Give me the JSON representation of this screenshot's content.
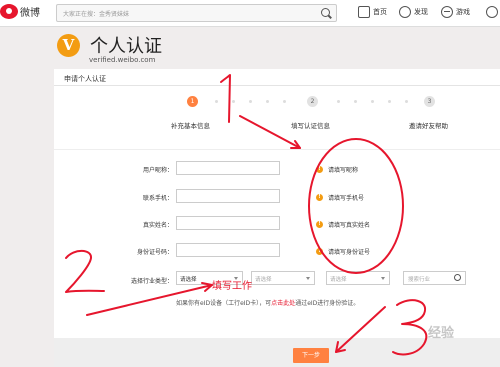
{
  "topbar": {
    "logo_text": "微博",
    "search_placeholder": "大家正在搜：金秀贤妹妹",
    "nav": {
      "home": "首页",
      "discover": "发现",
      "game": "游戏"
    }
  },
  "banner": {
    "badge": "V",
    "title": "个人认证",
    "subtitle": "verified.weibo.com"
  },
  "panel": {
    "title": "申请个人认证",
    "steps": [
      {
        "num": "1",
        "label": "补充基本信息",
        "active": true
      },
      {
        "num": "2",
        "label": "填写认证信息",
        "active": false
      },
      {
        "num": "3",
        "label": "邀请好友帮助",
        "active": false
      }
    ]
  },
  "form": {
    "fields": [
      {
        "label": "用户昵称：",
        "hint": "请填写昵称"
      },
      {
        "label": "联系手机：",
        "hint": "请填写手机号"
      },
      {
        "label": "真实姓名：",
        "hint": "请填写真实姓名"
      },
      {
        "label": "身份证号码：",
        "hint": "请填写身份证号"
      }
    ],
    "industry_label": "选择行业类型：",
    "selects": [
      "请选择",
      "请选择",
      "请选择"
    ],
    "industry_search_placeholder": "搜索行业",
    "eid_prefix": "如果你有eID设备（工行eID卡），可",
    "eid_link": "点击此处",
    "eid_suffix": "通过eID进行身份验证。",
    "next_label": "下一步"
  },
  "annotations": {
    "fill_job": "填写工作",
    "colors": {
      "ink": "#e6162d"
    }
  },
  "watermark": "经验"
}
